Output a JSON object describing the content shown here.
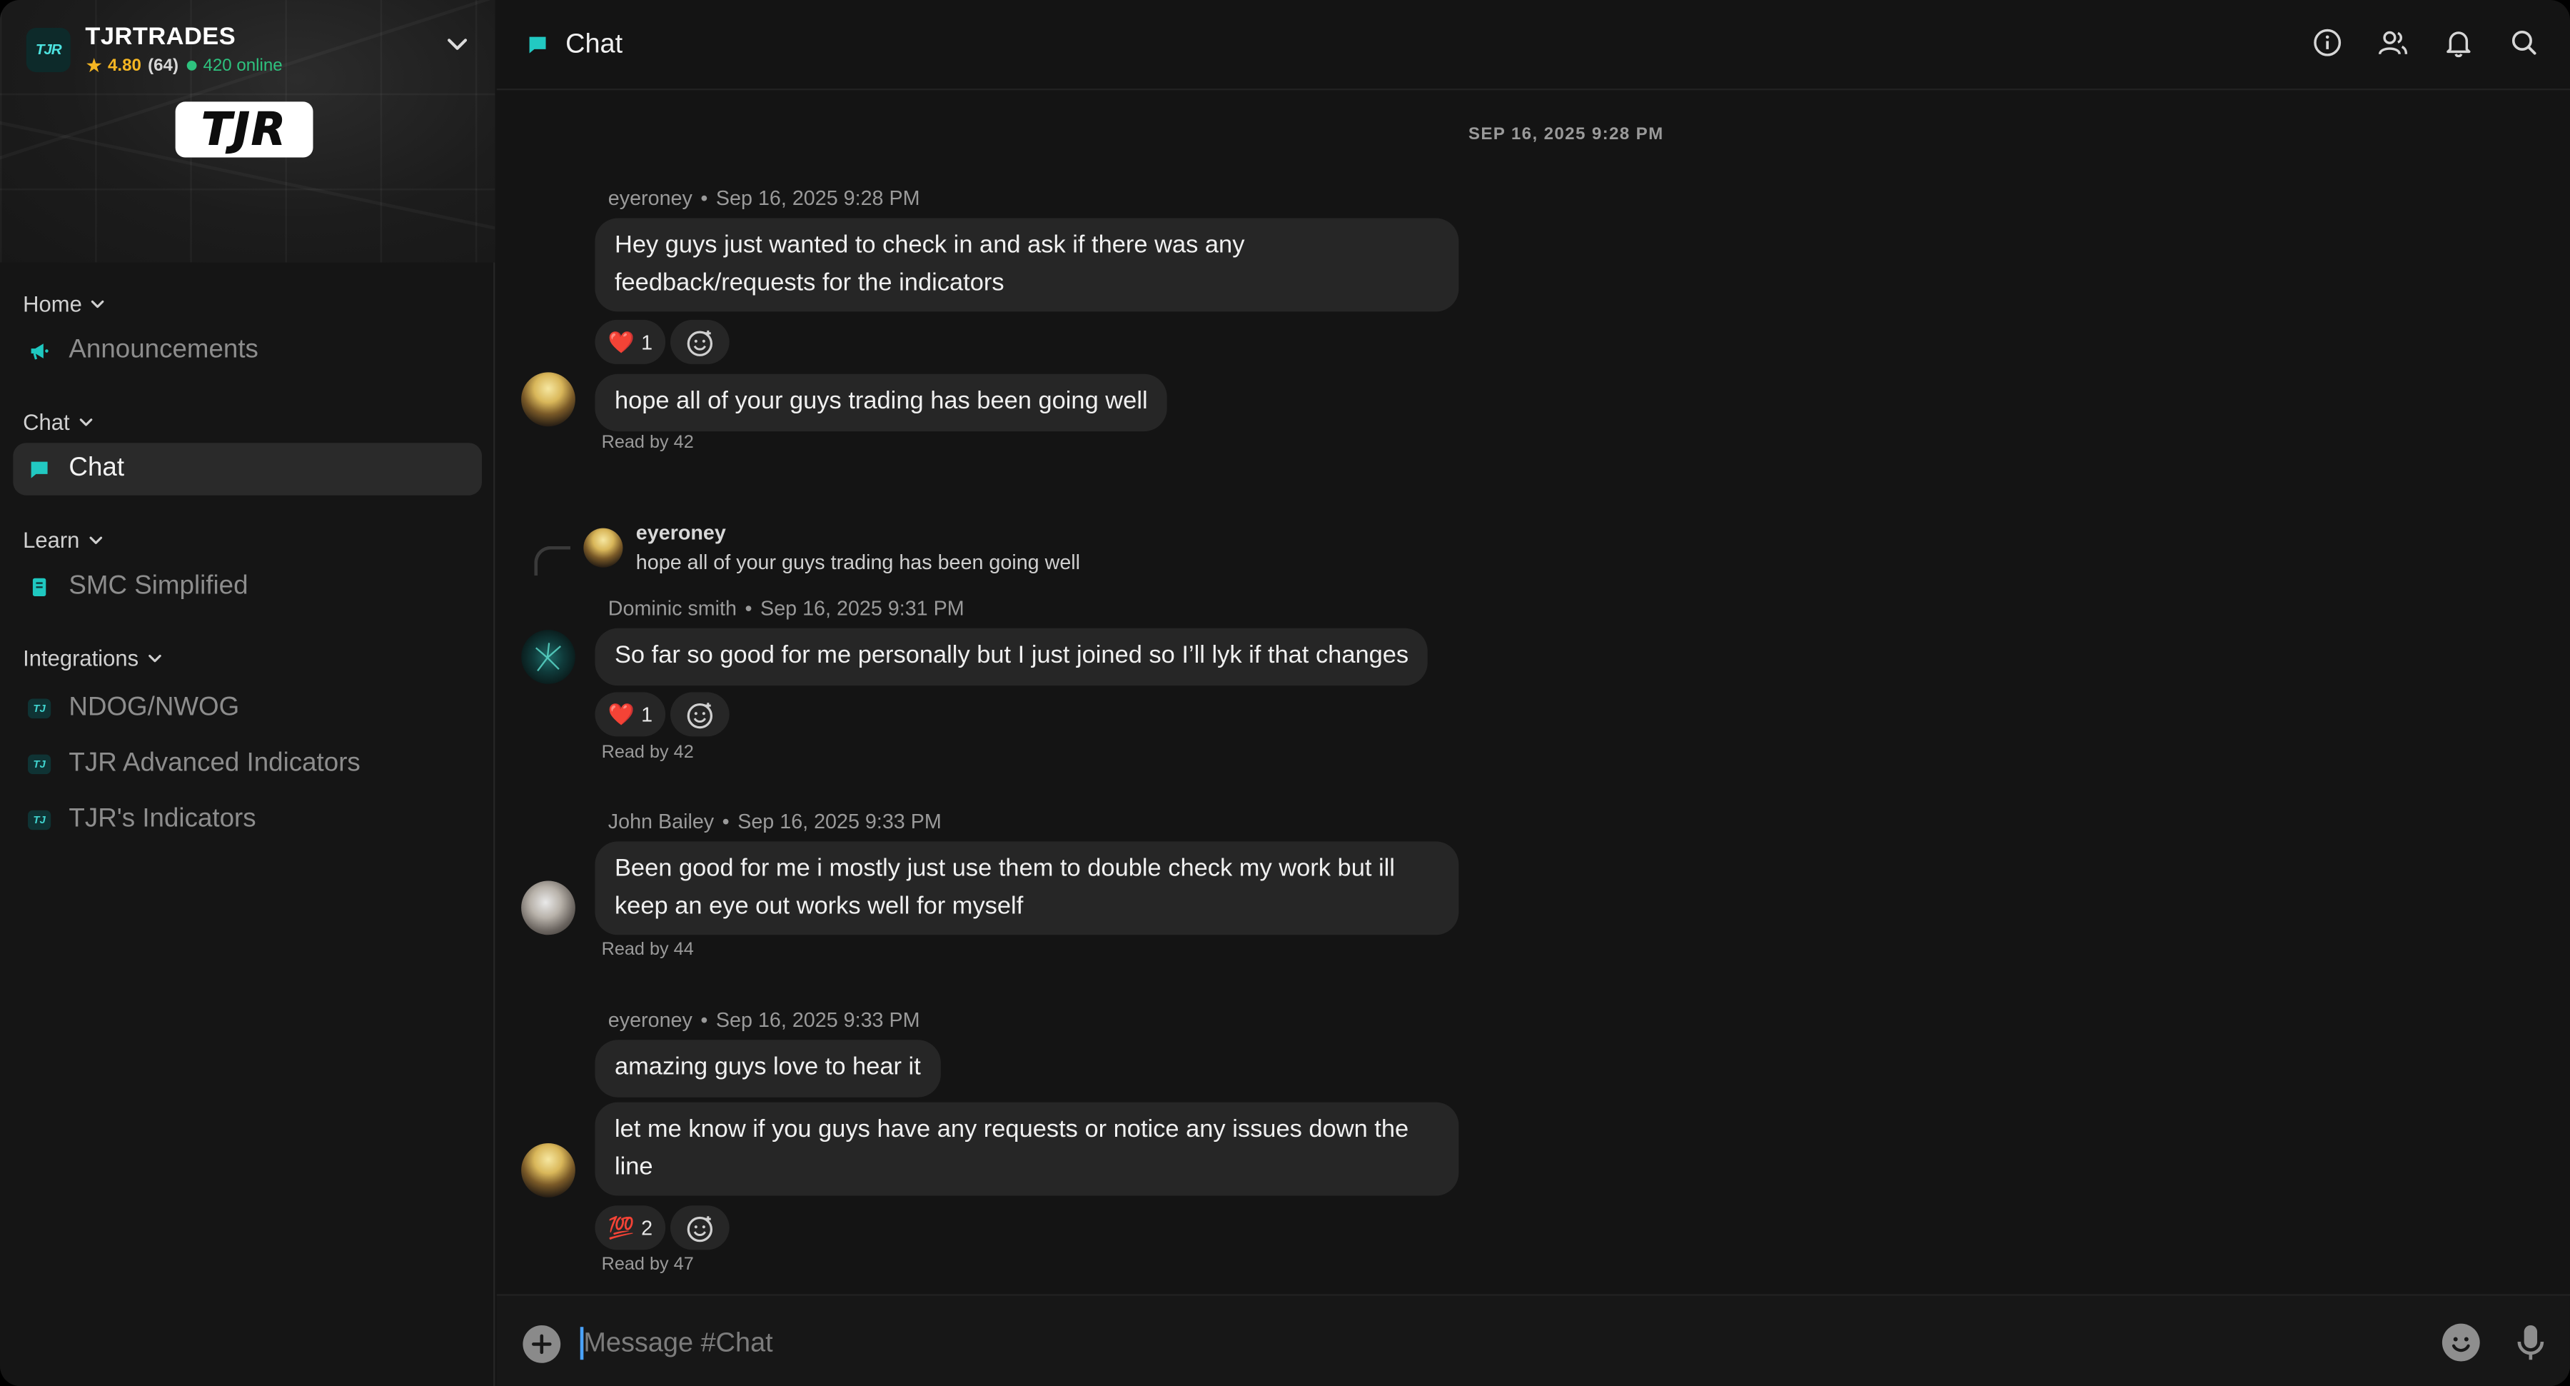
{
  "server": {
    "icon_text": "TJR",
    "name": "TJRTRADES",
    "rating": "4.80",
    "review_count": "(64)",
    "online": "420 online",
    "logo_text": "TJR"
  },
  "sidebar": {
    "sections": [
      {
        "label": "Home",
        "items": [
          {
            "label": "Announcements",
            "icon": "megaphone-icon"
          }
        ]
      },
      {
        "label": "Chat",
        "items": [
          {
            "label": "Chat",
            "icon": "chat-bubble-icon",
            "active": true
          }
        ]
      },
      {
        "label": "Learn",
        "items": [
          {
            "label": "SMC Simplified",
            "icon": "book-icon"
          }
        ]
      },
      {
        "label": "Integrations",
        "items": [
          {
            "label": "NDOG/NWOG",
            "icon": "tjr-app-icon"
          },
          {
            "label": "TJR Advanced Indicators",
            "icon": "tjr-app-icon"
          },
          {
            "label": "TJR's Indicators",
            "icon": "tjr-app-icon"
          }
        ]
      }
    ]
  },
  "header": {
    "title": "Chat",
    "actions": [
      "info-icon",
      "members-icon",
      "bell-icon",
      "search-icon"
    ]
  },
  "chat": {
    "date_separator": "SEP 16, 2025 9:28 PM",
    "groups": [
      {
        "author": "eyeroney",
        "time": "Sep 16, 2025 9:28 PM",
        "messages": [
          {
            "text": "Hey guys just wanted to check in and ask if there was any feedback/requests for the indicators",
            "reaction": {
              "emoji": "❤️",
              "count": "1"
            }
          },
          {
            "text": "hope all of your guys trading has been going well"
          }
        ],
        "read": "Read by 42"
      },
      {
        "reply": {
          "author": "eyeroney",
          "text": "hope all of your guys trading has been going well"
        },
        "author": "Dominic smith",
        "time": "Sep 16, 2025 9:31 PM",
        "messages": [
          {
            "text": "So far so good for me personally but I just joined so I’ll lyk if that changes",
            "reaction": {
              "emoji": "❤️",
              "count": "1"
            }
          }
        ],
        "read": "Read by 42"
      },
      {
        "author": "John Bailey",
        "time": "Sep 16, 2025 9:33 PM",
        "messages": [
          {
            "text": "Been good for me i mostly just use them to double check my work but ill keep an eye out works well for myself"
          }
        ],
        "read": "Read by 44"
      },
      {
        "author": "eyeroney",
        "time": "Sep 16, 2025 9:33 PM",
        "messages": [
          {
            "text": "amazing guys love to hear it"
          },
          {
            "text": "let me know if you guys have any requests or notice any issues down the line",
            "reaction": {
              "emoji": "💯",
              "count": "2"
            }
          }
        ],
        "read": "Read by 47"
      }
    ]
  },
  "composer": {
    "placeholder": "Message #Chat",
    "value": ""
  },
  "colors": {
    "accent": "#4de3e0",
    "online": "#2ec27e",
    "rating": "#f5b623",
    "background": "#141414",
    "bubble": "#262626"
  }
}
